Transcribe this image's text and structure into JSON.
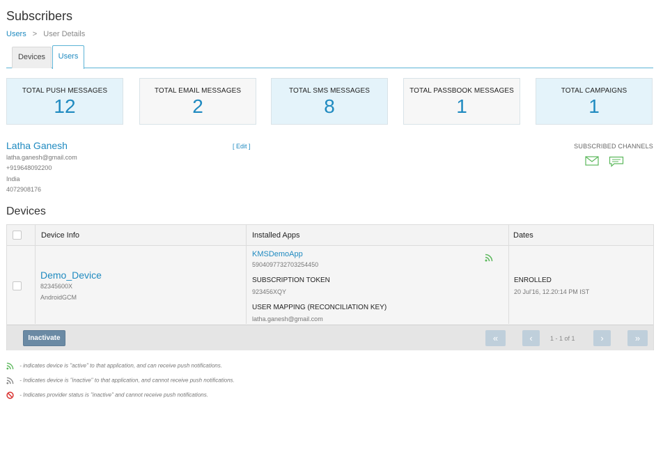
{
  "header": {
    "title": "Subscribers",
    "breadcrumb": [
      "Users",
      "User Details"
    ],
    "breadcrumb_sep": ">"
  },
  "tabs": [
    {
      "label": "Devices",
      "active": false
    },
    {
      "label": "Users",
      "active": true
    }
  ],
  "stats": [
    {
      "label": "TOTAL PUSH MESSAGES",
      "value": "12"
    },
    {
      "label": "TOTAL EMAIL MESSAGES",
      "value": "2"
    },
    {
      "label": "TOTAL SMS MESSAGES",
      "value": "8"
    },
    {
      "label": "TOTAL PASSBOOK MESSAGES",
      "value": "1"
    },
    {
      "label": "TOTAL CAMPAIGNS",
      "value": "1"
    }
  ],
  "user": {
    "name": "Latha Ganesh",
    "edit_label": "[ Edit ]",
    "email": "latha.ganesh@gmail.com",
    "phone": "+919648092200",
    "country": "India",
    "id": "4072908176",
    "subscribed_label": "SUBSCRIBED CHANNELS",
    "channels": [
      "email-icon",
      "sms-icon"
    ]
  },
  "devices": {
    "title": "Devices",
    "columns": [
      "Device Info",
      "Installed Apps",
      "Dates"
    ],
    "rows": [
      {
        "device_name": "Demo_Device",
        "device_id": "82345600X",
        "platform": "AndroidGCM",
        "app_name": "KMSDemoApp",
        "app_id": "5904097732703254450",
        "token_label": "SUBSCRIPTION TOKEN",
        "token_value": "923456XQY",
        "mapping_label": "USER MAPPING (RECONCILIATION KEY)",
        "mapping_value": "latha.ganesh@gmail.com",
        "status": "ENROLLED",
        "date": "20 Jul'16, 12.20:14 PM IST"
      }
    ],
    "inactivate_label": "Inactivate",
    "pagination": "1 - 1 of 1"
  },
  "legend": [
    {
      "icon": "rss-active-icon",
      "text": "- indicates device is \"active\" to that application, and can receive push notifications."
    },
    {
      "icon": "rss-inactive-icon",
      "text": "- Indicates device is \"inactive\" to that application, and cannot receive push notifications."
    },
    {
      "icon": "provider-inactive-icon",
      "text": "- Indicates provider status is \"inactive\" and cannot receive push notifications."
    }
  ],
  "colors": {
    "accent": "#1f8ac0",
    "active_green": "#5cb85c",
    "inactive_gray": "#888888",
    "danger_red": "#d9302f"
  }
}
